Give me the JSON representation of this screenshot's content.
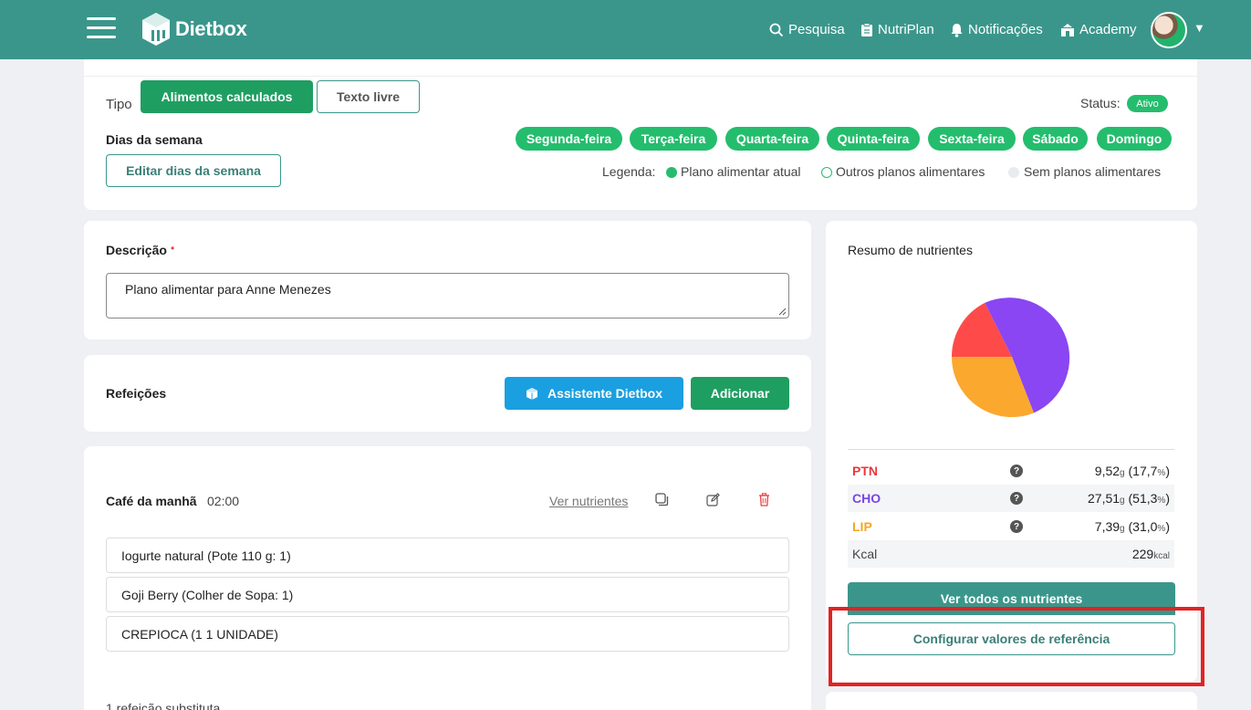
{
  "header": {
    "brand": "Dietbox",
    "nav": {
      "search": "Pesquisa",
      "nutriplan": "NutriPlan",
      "notifications": "Notificações",
      "academy": "Academy"
    }
  },
  "type_section": {
    "tipo_label": "Tipo",
    "tab_calculated": "Alimentos calculados",
    "tab_free_text": "Texto livre",
    "status_label": "Status:",
    "status_value": "Ativo",
    "days_label": "Dias da semana",
    "edit_days_button": "Editar dias da semana",
    "days": [
      "Segunda-feira",
      "Terça-feira",
      "Quarta-feira",
      "Quinta-feira",
      "Sexta-feira",
      "Sábado",
      "Domingo"
    ],
    "legend_label": "Legenda:",
    "legend_current": "Plano alimentar atual",
    "legend_other": "Outros planos alimentares",
    "legend_none": "Sem planos alimentares"
  },
  "description": {
    "label": "Descrição",
    "required_mark": "•",
    "value": "Plano alimentar para Anne Menezes"
  },
  "meals": {
    "label": "Refeições",
    "assistant_button": "Assistente Dietbox",
    "add_button": "Adicionar"
  },
  "meal": {
    "name": "Café da manhã",
    "time": "02:00",
    "view_nutrients": "Ver nutrientes",
    "foods": [
      "Iogurte natural (Pote 110 g: 1)",
      "Goji Berry (Colher de Sopa: 1)",
      "CREPIOCA (1 1 UNIDADE)"
    ],
    "substitute_text": "1 refeição substituta"
  },
  "summary": {
    "title": "Resumo de nutrientes",
    "nutrients": [
      {
        "name": "PTN",
        "color": "#e8383d",
        "grams": "9,52",
        "gram_unit": "g",
        "percent": "(17,7",
        "pct_unit": "%",
        "close": ")"
      },
      {
        "name": "CHO",
        "color": "#7a45e6",
        "grams": "27,51",
        "gram_unit": "g",
        "percent": "(51,3",
        "pct_unit": "%",
        "close": ")"
      },
      {
        "name": "LIP",
        "color": "#f5a524",
        "grams": "7,39",
        "gram_unit": "g",
        "percent": "(31,0",
        "pct_unit": "%",
        "close": ")"
      }
    ],
    "kcal_label": "Kcal",
    "kcal_value": "229",
    "kcal_unit": "kcal",
    "view_all_button": "Ver todos os nutrientes",
    "configure_button": "Configurar valores de referência",
    "qmark": "?"
  },
  "colors": {
    "header": "#3a968b",
    "ptn": "#ff4a4a",
    "cho": "#8a46f2",
    "lip": "#fba82f",
    "highlight": "#e32222"
  }
}
